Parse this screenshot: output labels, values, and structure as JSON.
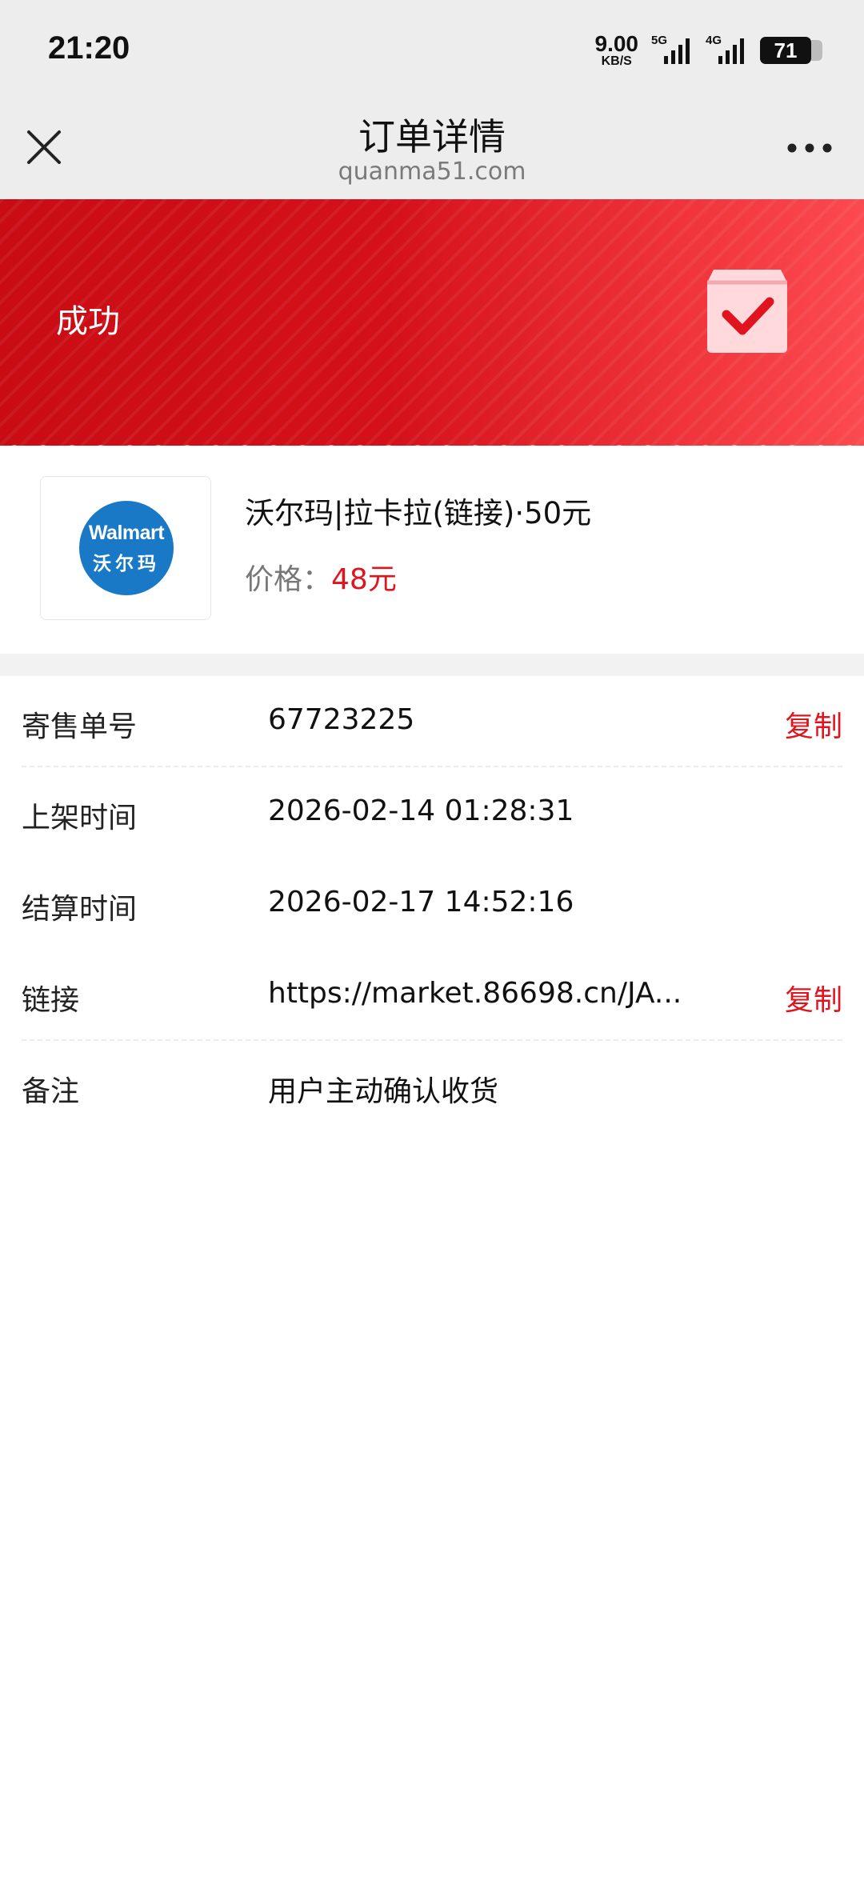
{
  "status_bar": {
    "time": "21:20",
    "net_speed": "9.00",
    "net_speed_unit": "KB/S",
    "signal_1_type": "5G",
    "signal_2_type": "4G",
    "battery": "71"
  },
  "nav": {
    "title": "订单详情",
    "subtitle": "quanma51.com",
    "close_icon": "close-icon",
    "more_icon": "more-horizontal-icon"
  },
  "banner": {
    "status": "成功",
    "icon": "check-bag-icon",
    "color": "#d51118"
  },
  "product": {
    "logo_en": "Walmart",
    "logo_cn": "沃尔玛",
    "name": "沃尔玛|拉卡拉(链接)·50元",
    "price_label": "价格：",
    "price_value": "48元"
  },
  "details": [
    {
      "label": "寄售单号",
      "value": "67723225",
      "action": "复制"
    },
    {
      "label": "上架时间",
      "value": "2026-02-14 01:28:31"
    },
    {
      "label": "结算时间",
      "value": "2026-02-17 14:52:16"
    },
    {
      "label": "链接",
      "value": "https://market.86698.cn/JA...",
      "action": "复制"
    },
    {
      "label": "备注",
      "value": "用户主动确认收货"
    }
  ],
  "colors": {
    "accent": "#e0141e",
    "nav_bg": "#ededed",
    "walmart_blue": "#1a79c6"
  }
}
